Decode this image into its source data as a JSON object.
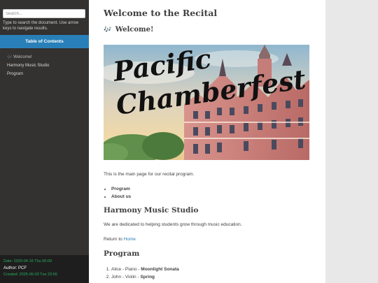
{
  "sidebar": {
    "search_placeholder": "Search...",
    "search_help": "Type to search the document. Use arrow keys to navigate results.",
    "toc_header": "Table of Contents",
    "toc_items": [
      {
        "label": "Welcome!",
        "icon": "musical-notes-icon"
      },
      {
        "label": "Harmony Music Studio"
      },
      {
        "label": "Program"
      }
    ],
    "meta": {
      "date": "Date: 2020-04-16 Thu 00:00",
      "author": "Author: PCF",
      "created": "Created: 2025-06-03 Tue 23:56"
    }
  },
  "main": {
    "title": "Welcome to the Recital",
    "section1_icon": "🎶",
    "section1_title": "Welcome!",
    "banner_line1": "Pacific",
    "banner_line2": "Chamberfest",
    "intro_text": "This is the main page for our recital program.",
    "links": [
      "Program",
      "About us"
    ],
    "section2_title": "Harmony Music Studio",
    "section2_text": "We are dedicated to helping students grow through music education.",
    "return_text": "Return to",
    "return_link": "Home",
    "section3_title": "Program",
    "program": [
      {
        "performer": "Alice - Piano - ",
        "piece": "Moonlight Sonata"
      },
      {
        "performer": "John - Violin - ",
        "piece": "Spring"
      }
    ]
  },
  "colors": {
    "sidebar_bg": "#343131",
    "toc_header_bg": "#2980b9",
    "link": "#2980b9",
    "meta_green": "#27ae60"
  }
}
